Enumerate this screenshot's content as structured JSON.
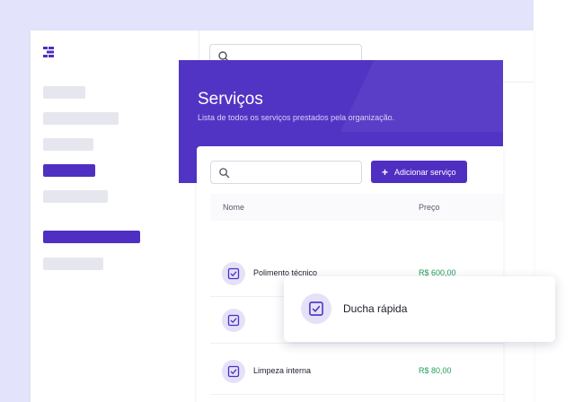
{
  "header": {
    "search_placeholder": ""
  },
  "banner": {
    "title": "Serviços",
    "subtitle": "Lista de todos os serviços prestados pela organização."
  },
  "toolbar": {
    "search_placeholder": "",
    "add_label": "Adicionar serviço"
  },
  "table": {
    "columns": [
      "Nome",
      "Preço"
    ],
    "rows": [
      {
        "name": "Polimento técnico",
        "price": "R$ 600,00"
      },
      {
        "name": "",
        "price": ""
      },
      {
        "name": "Limpeza interna",
        "price": "R$ 80,00"
      }
    ]
  },
  "popup": {
    "label": "Ducha rápida"
  },
  "colors": {
    "accent": "#4f2fc2",
    "price": "#22a05a",
    "background": "#e3e4fb"
  }
}
